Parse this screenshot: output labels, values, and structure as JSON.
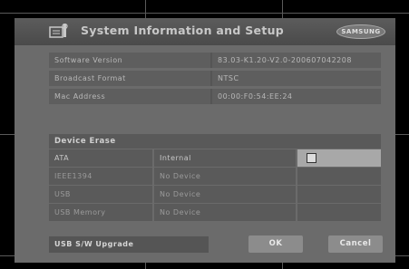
{
  "header": {
    "title": "System Information and Setup",
    "logo_text": "SAMSUNG",
    "icon": "settings-panel-icon"
  },
  "info_rows": [
    {
      "label": "Software Version",
      "value": "83.03-K1.20-V2.0-200607042208"
    },
    {
      "label": "Broadcast Format",
      "value": "NTSC"
    },
    {
      "label": "Mac Address",
      "value": "00:00:F0:54:EE:24"
    }
  ],
  "device_erase": {
    "heading": "Device Erase",
    "rows": [
      {
        "name": "ATA",
        "status": "Internal",
        "checkbox": true
      },
      {
        "name": "IEEE1394",
        "status": "No Device"
      },
      {
        "name": "USB",
        "status": "No Device"
      },
      {
        "name": "USB Memory",
        "status": "No Device"
      }
    ]
  },
  "buttons": {
    "usb_upgrade": "USB S/W Upgrade",
    "ok": "OK",
    "cancel": "Cancel"
  },
  "colors": {
    "background": "#000000",
    "panel": "#6b6b6b",
    "selected": "#a8a8a8"
  }
}
